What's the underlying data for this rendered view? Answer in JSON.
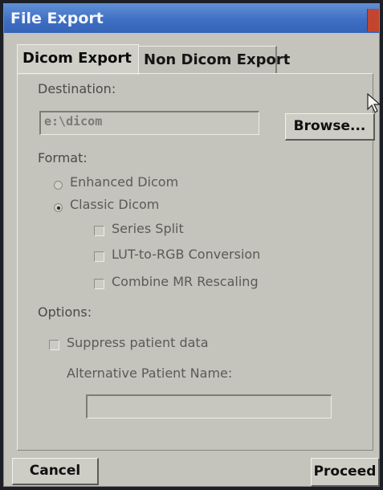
{
  "window": {
    "title": "File Export"
  },
  "tabs": [
    {
      "label": "Dicom Export",
      "active": true
    },
    {
      "label": "Non Dicom Export",
      "active": false
    }
  ],
  "destination": {
    "label": "Destination:",
    "value": "e:\\dicom",
    "browse_label": "Browse..."
  },
  "format": {
    "label": "Format:",
    "options": [
      {
        "label": "Enhanced Dicom",
        "selected": false
      },
      {
        "label": "Classic Dicom",
        "selected": true
      }
    ],
    "checkboxes": [
      {
        "label": "Series Split",
        "checked": false
      },
      {
        "label": "LUT-to-RGB Conversion",
        "checked": false
      },
      {
        "label": "Combine MR Rescaling",
        "checked": false
      }
    ]
  },
  "options": {
    "label": "Options:",
    "suppress_label": "Suppress patient data",
    "suppress_checked": false,
    "alt_name_label": "Alternative Patient Name:",
    "alt_name_value": ""
  },
  "footer": {
    "cancel_label": "Cancel",
    "proceed_label": "Proceed"
  }
}
